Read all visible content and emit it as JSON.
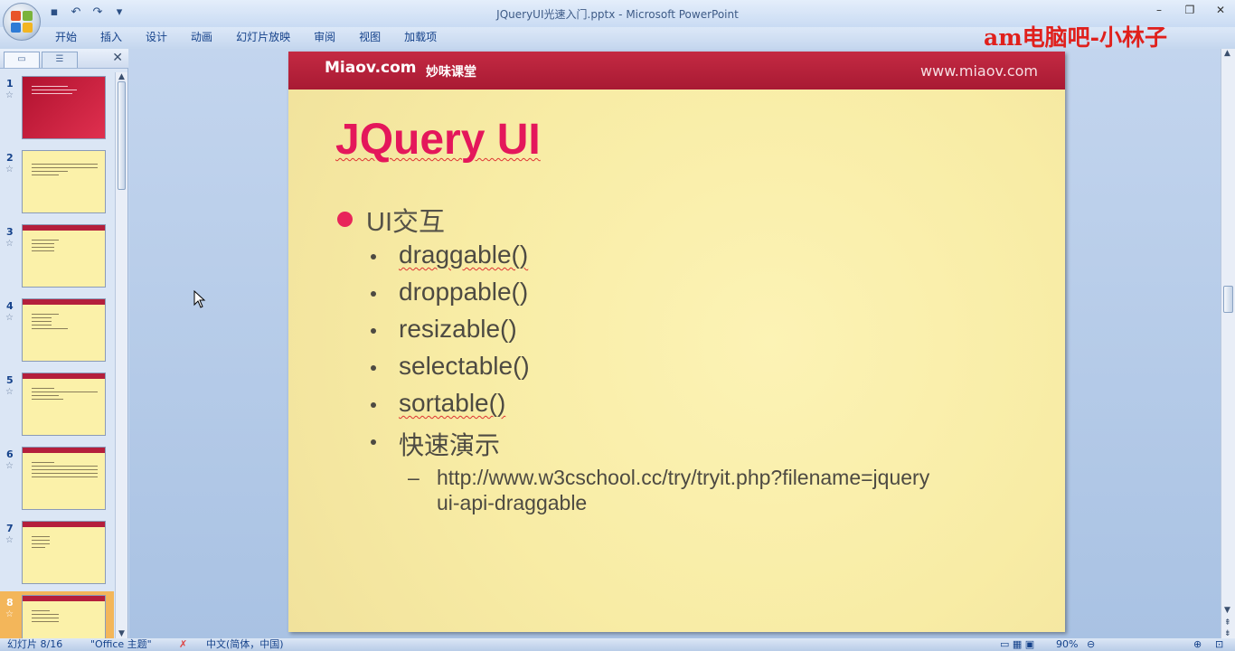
{
  "window": {
    "title": "JQueryUI光速入门.pptx - Microsoft PowerPoint",
    "watermark": "am电脑吧-小林子"
  },
  "ribbon": {
    "tabs": [
      "开始",
      "插入",
      "设计",
      "动画",
      "幻灯片放映",
      "审阅",
      "视图",
      "加载项"
    ]
  },
  "thumbnails": {
    "numbers": [
      "1",
      "2",
      "3",
      "4",
      "5",
      "6",
      "7",
      "8"
    ],
    "active_index": 8
  },
  "slide": {
    "brand": "Miaov.com",
    "brand_cn": "妙味课堂",
    "site": "www.miaov.com",
    "title": "JQuery UI",
    "bullet_main": "UI交互",
    "sub_items": [
      "draggable()",
      "droppable()",
      "resizable()",
      "selectable()",
      "sortable()",
      "快速演示"
    ],
    "link_line1": "http://www.w3cschool.cc/try/tryit.php?filename=jquery",
    "link_line2": "ui-api-draggable",
    "dash": "–"
  },
  "status": {
    "slide_counter": "幻灯片 8/16",
    "theme": "\"Office 主题\"",
    "language": "中文(简体，中国)",
    "zoom": "90%"
  },
  "colors": {
    "accent": "#e4175b",
    "header": "#b41f3c",
    "slide_bg": "#f8eca5"
  }
}
